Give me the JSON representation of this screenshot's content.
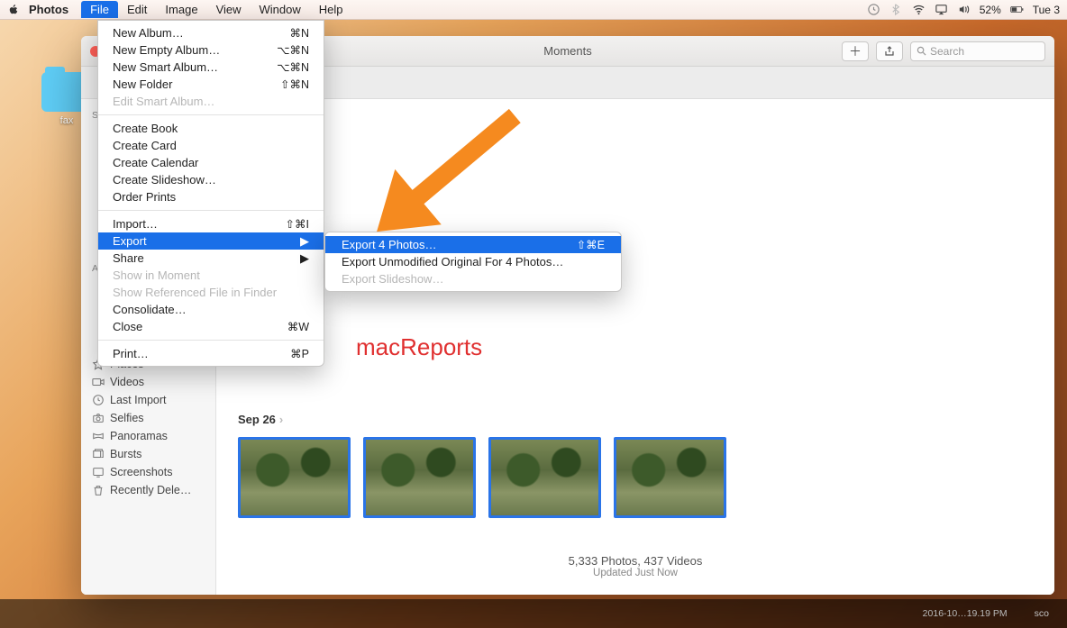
{
  "menubar": {
    "app": "Photos",
    "items": [
      "File",
      "Edit",
      "Image",
      "View",
      "Window",
      "Help"
    ],
    "active_index": 0,
    "battery": "52%",
    "clock": "Tue 3"
  },
  "desktop": {
    "folder_label": "fax"
  },
  "window": {
    "title": "Moments",
    "search_placeholder": "Search"
  },
  "sidebar": {
    "header_shared": "Sh",
    "header_albums": "Al",
    "items": [
      {
        "icon": "pin",
        "label": "Places"
      },
      {
        "icon": "video",
        "label": "Videos"
      },
      {
        "icon": "clock",
        "label": "Last Import"
      },
      {
        "icon": "camera",
        "label": "Selfies"
      },
      {
        "icon": "pano",
        "label": "Panoramas"
      },
      {
        "icon": "burst",
        "label": "Bursts"
      },
      {
        "icon": "screenshot",
        "label": "Screenshots"
      },
      {
        "icon": "trash",
        "label": "Recently Dele…"
      }
    ]
  },
  "content": {
    "date": "Sep 26",
    "footer_main": "5,333 Photos, 437 Videos",
    "footer_sub": "Updated Just Now"
  },
  "watermark": "macReports",
  "file_menu": {
    "groups": [
      [
        {
          "label": "New Album…",
          "shortcut": "⌘N"
        },
        {
          "label": "New Empty Album…",
          "shortcut": "⌥⌘N"
        },
        {
          "label": "New Smart Album…",
          "shortcut": "⌥⌘N"
        },
        {
          "label": "New Folder",
          "shortcut": "⇧⌘N"
        },
        {
          "label": "Edit Smart Album…",
          "disabled": true
        }
      ],
      [
        {
          "label": "Create Book"
        },
        {
          "label": "Create Card"
        },
        {
          "label": "Create Calendar"
        },
        {
          "label": "Create Slideshow…"
        },
        {
          "label": "Order Prints"
        }
      ],
      [
        {
          "label": "Import…",
          "shortcut": "⇧⌘I"
        },
        {
          "label": "Export",
          "submenu": true,
          "highlight": true
        },
        {
          "label": "Share",
          "submenu": true
        },
        {
          "label": "Show in Moment",
          "disabled": true
        },
        {
          "label": "Show Referenced File in Finder",
          "disabled": true
        },
        {
          "label": "Consolidate…"
        },
        {
          "label": "Close",
          "shortcut": "⌘W"
        }
      ],
      [
        {
          "label": "Print…",
          "shortcut": "⌘P"
        }
      ]
    ]
  },
  "export_submenu": [
    {
      "label": "Export 4 Photos…",
      "shortcut": "⇧⌘E",
      "highlight": true
    },
    {
      "label": "Export Unmodified Original For 4 Photos…"
    },
    {
      "label": "Export Slideshow…",
      "disabled": true
    }
  ],
  "dock": {
    "label1": "2016-10…19.19 PM",
    "label2": "sco"
  }
}
